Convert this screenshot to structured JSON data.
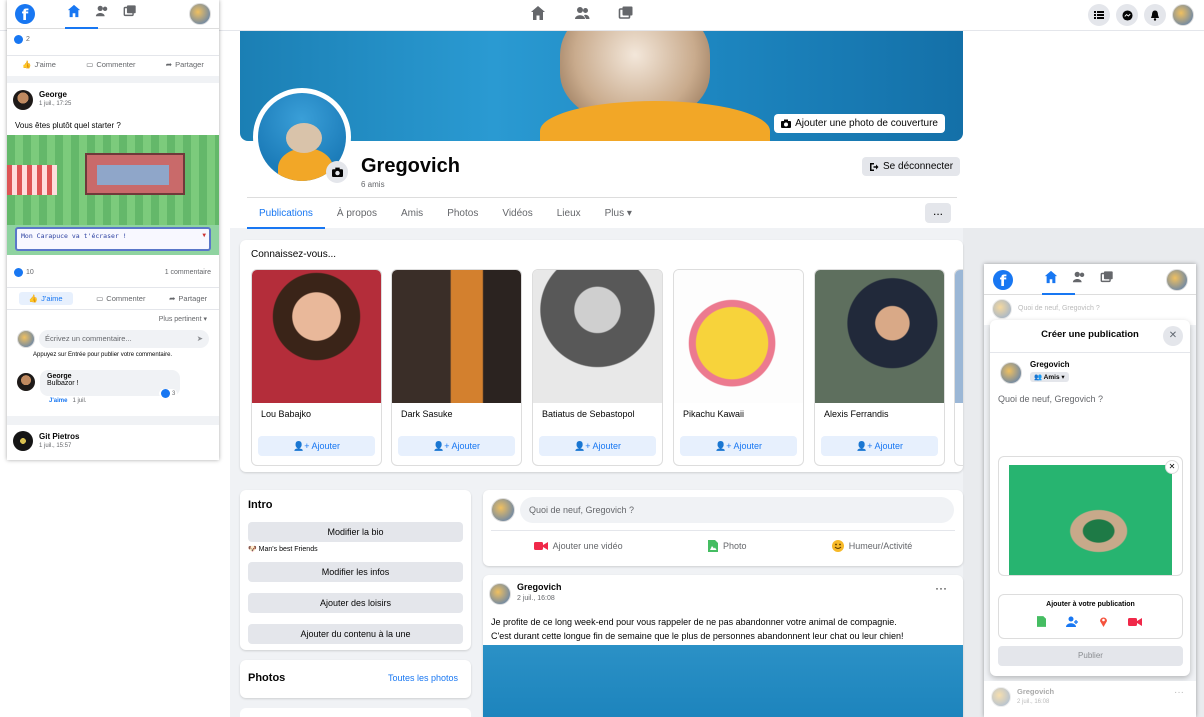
{
  "top_nav": {
    "icons": [
      "home-icon",
      "friends-icon",
      "watch-icon"
    ],
    "right_icons": [
      "menu-icon",
      "messenger-icon",
      "bell-icon",
      "avatar"
    ]
  },
  "cover": {
    "add_cover_label": "Ajouter une photo de couverture"
  },
  "profile": {
    "name": "Gregovich",
    "friends": "6 amis",
    "logout_label": "Se déconnecter"
  },
  "tabs": [
    "Publications",
    "À propos",
    "Amis",
    "Photos",
    "Vidéos",
    "Lieux",
    "Plus"
  ],
  "tabs_more": "...",
  "suggestions": {
    "title": "Connaissez-vous...",
    "add_label": "Ajouter",
    "people": [
      {
        "name": "Lou Babajko",
        "color": "#c0424a"
      },
      {
        "name": "Dark Sasuke",
        "color": "#6b5a4a"
      },
      {
        "name": "Batiatus de Sebastopol",
        "color": "#9a9a9a"
      },
      {
        "name": "Pikachu Kawaii",
        "color": "#f6d33c"
      },
      {
        "name": "Alexis Ferrandis",
        "color": "#4b5d4e"
      }
    ]
  },
  "intro": {
    "title": "Intro",
    "edit_bio": "Modifier la bio",
    "bio": "Man's best Friends",
    "edit_info": "Modifier les infos",
    "add_hobbies": "Ajouter des loisirs",
    "add_featured": "Ajouter du contenu à la une"
  },
  "photos_box": {
    "title": "Photos",
    "all_link": "Toutes les photos"
  },
  "composer": {
    "placeholder": "Quoi de neuf, Gregovich ?",
    "video": "Ajouter une vidéo",
    "photo": "Photo",
    "mood": "Humeur/Activité"
  },
  "post": {
    "author": "Gregovich",
    "date": "2 juil., 16:08",
    "line1": "Je profite de ce long week-end pour vous rappeler de ne pas abandonner votre animal de compagnie.",
    "line2": "C'est durant cette longue fin de semaine que le plus de personnes abandonnent leur chat ou leur chien!"
  },
  "left_mobile": {
    "top_likes": "2",
    "like": "J'aime",
    "comment": "Commenter",
    "share": "Partager",
    "post_author": "George",
    "post_date": "1 juil., 17:25",
    "post_text": "Vous êtes plutôt quel starter ?",
    "game_text": "Mon Carapuce va t'écraser !",
    "likes": "10",
    "comments": "1 commentaire",
    "sort": "Plus pertinent",
    "comment_placeholder": "Écrivez un commentaire...",
    "comment_hint": "Appuyez sur Entrée pour publier votre commentaire.",
    "reply_author": "George",
    "reply_text": "Bulbazor !",
    "reply_like": "J'aime",
    "reply_date": "1 juil.",
    "reply_likes": "3",
    "next_author": "Git Pietros",
    "next_date": "1 juil., 15:57"
  },
  "right_mobile": {
    "top_placeholder": "Quoi de neuf, Gregovich ?",
    "modal_title": "Créer une publication",
    "author": "Gregovich",
    "audience": "Amis",
    "placeholder": "Quoi de neuf, Gregovich ?",
    "add_to_post": "Ajouter à votre publication",
    "publish": "Publier",
    "bottom_author": "Gregovich",
    "bottom_date": "2 juil., 16:08"
  }
}
